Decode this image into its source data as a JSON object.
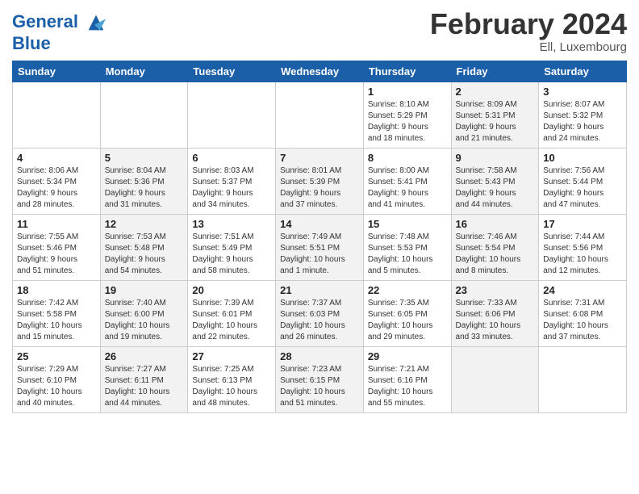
{
  "header": {
    "logo_line1": "General",
    "logo_line2": "Blue",
    "month_title": "February 2024",
    "location": "Ell, Luxembourg"
  },
  "weekdays": [
    "Sunday",
    "Monday",
    "Tuesday",
    "Wednesday",
    "Thursday",
    "Friday",
    "Saturday"
  ],
  "weeks": [
    [
      {
        "day": "",
        "info": "",
        "shaded": false
      },
      {
        "day": "",
        "info": "",
        "shaded": false
      },
      {
        "day": "",
        "info": "",
        "shaded": false
      },
      {
        "day": "",
        "info": "",
        "shaded": false
      },
      {
        "day": "1",
        "info": "Sunrise: 8:10 AM\nSunset: 5:29 PM\nDaylight: 9 hours\nand 18 minutes.",
        "shaded": false
      },
      {
        "day": "2",
        "info": "Sunrise: 8:09 AM\nSunset: 5:31 PM\nDaylight: 9 hours\nand 21 minutes.",
        "shaded": true
      },
      {
        "day": "3",
        "info": "Sunrise: 8:07 AM\nSunset: 5:32 PM\nDaylight: 9 hours\nand 24 minutes.",
        "shaded": false
      }
    ],
    [
      {
        "day": "4",
        "info": "Sunrise: 8:06 AM\nSunset: 5:34 PM\nDaylight: 9 hours\nand 28 minutes.",
        "shaded": false
      },
      {
        "day": "5",
        "info": "Sunrise: 8:04 AM\nSunset: 5:36 PM\nDaylight: 9 hours\nand 31 minutes.",
        "shaded": true
      },
      {
        "day": "6",
        "info": "Sunrise: 8:03 AM\nSunset: 5:37 PM\nDaylight: 9 hours\nand 34 minutes.",
        "shaded": false
      },
      {
        "day": "7",
        "info": "Sunrise: 8:01 AM\nSunset: 5:39 PM\nDaylight: 9 hours\nand 37 minutes.",
        "shaded": true
      },
      {
        "day": "8",
        "info": "Sunrise: 8:00 AM\nSunset: 5:41 PM\nDaylight: 9 hours\nand 41 minutes.",
        "shaded": false
      },
      {
        "day": "9",
        "info": "Sunrise: 7:58 AM\nSunset: 5:43 PM\nDaylight: 9 hours\nand 44 minutes.",
        "shaded": true
      },
      {
        "day": "10",
        "info": "Sunrise: 7:56 AM\nSunset: 5:44 PM\nDaylight: 9 hours\nand 47 minutes.",
        "shaded": false
      }
    ],
    [
      {
        "day": "11",
        "info": "Sunrise: 7:55 AM\nSunset: 5:46 PM\nDaylight: 9 hours\nand 51 minutes.",
        "shaded": false
      },
      {
        "day": "12",
        "info": "Sunrise: 7:53 AM\nSunset: 5:48 PM\nDaylight: 9 hours\nand 54 minutes.",
        "shaded": true
      },
      {
        "day": "13",
        "info": "Sunrise: 7:51 AM\nSunset: 5:49 PM\nDaylight: 9 hours\nand 58 minutes.",
        "shaded": false
      },
      {
        "day": "14",
        "info": "Sunrise: 7:49 AM\nSunset: 5:51 PM\nDaylight: 10 hours\nand 1 minute.",
        "shaded": true
      },
      {
        "day": "15",
        "info": "Sunrise: 7:48 AM\nSunset: 5:53 PM\nDaylight: 10 hours\nand 5 minutes.",
        "shaded": false
      },
      {
        "day": "16",
        "info": "Sunrise: 7:46 AM\nSunset: 5:54 PM\nDaylight: 10 hours\nand 8 minutes.",
        "shaded": true
      },
      {
        "day": "17",
        "info": "Sunrise: 7:44 AM\nSunset: 5:56 PM\nDaylight: 10 hours\nand 12 minutes.",
        "shaded": false
      }
    ],
    [
      {
        "day": "18",
        "info": "Sunrise: 7:42 AM\nSunset: 5:58 PM\nDaylight: 10 hours\nand 15 minutes.",
        "shaded": false
      },
      {
        "day": "19",
        "info": "Sunrise: 7:40 AM\nSunset: 6:00 PM\nDaylight: 10 hours\nand 19 minutes.",
        "shaded": true
      },
      {
        "day": "20",
        "info": "Sunrise: 7:39 AM\nSunset: 6:01 PM\nDaylight: 10 hours\nand 22 minutes.",
        "shaded": false
      },
      {
        "day": "21",
        "info": "Sunrise: 7:37 AM\nSunset: 6:03 PM\nDaylight: 10 hours\nand 26 minutes.",
        "shaded": true
      },
      {
        "day": "22",
        "info": "Sunrise: 7:35 AM\nSunset: 6:05 PM\nDaylight: 10 hours\nand 29 minutes.",
        "shaded": false
      },
      {
        "day": "23",
        "info": "Sunrise: 7:33 AM\nSunset: 6:06 PM\nDaylight: 10 hours\nand 33 minutes.",
        "shaded": true
      },
      {
        "day": "24",
        "info": "Sunrise: 7:31 AM\nSunset: 6:08 PM\nDaylight: 10 hours\nand 37 minutes.",
        "shaded": false
      }
    ],
    [
      {
        "day": "25",
        "info": "Sunrise: 7:29 AM\nSunset: 6:10 PM\nDaylight: 10 hours\nand 40 minutes.",
        "shaded": false
      },
      {
        "day": "26",
        "info": "Sunrise: 7:27 AM\nSunset: 6:11 PM\nDaylight: 10 hours\nand 44 minutes.",
        "shaded": true
      },
      {
        "day": "27",
        "info": "Sunrise: 7:25 AM\nSunset: 6:13 PM\nDaylight: 10 hours\nand 48 minutes.",
        "shaded": false
      },
      {
        "day": "28",
        "info": "Sunrise: 7:23 AM\nSunset: 6:15 PM\nDaylight: 10 hours\nand 51 minutes.",
        "shaded": true
      },
      {
        "day": "29",
        "info": "Sunrise: 7:21 AM\nSunset: 6:16 PM\nDaylight: 10 hours\nand 55 minutes.",
        "shaded": false
      },
      {
        "day": "",
        "info": "",
        "shaded": true
      },
      {
        "day": "",
        "info": "",
        "shaded": false
      }
    ]
  ]
}
